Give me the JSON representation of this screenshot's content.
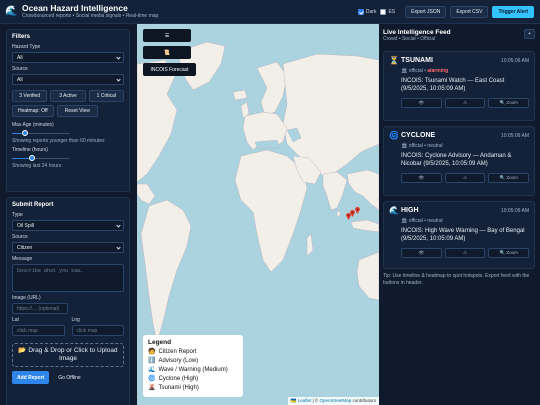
{
  "header": {
    "title": "Ocean Hazard Intelligence",
    "subtitle": "Crowdsourced reports • Social media signals • Real-time map",
    "dark_label": "Dark",
    "es_label": "ES",
    "export_json": "Export JSON",
    "export_csv": "Export CSV",
    "trigger_alert": "Trigger Alert",
    "dark_checked": true,
    "es_checked": false
  },
  "filters": {
    "title": "Filters",
    "hazard_type_label": "Hazard Type",
    "hazard_type_value": "All",
    "source_label": "Source",
    "source_value": "All",
    "verified_btn": "3 Verified",
    "active_btn": "3 Active",
    "critical_btn": "1 Critical",
    "heatmap_btn": "Heatmap: Off",
    "reset_btn": "Reset View",
    "max_age_label": "Max Age (minutes)",
    "max_age_fraction": 0.22,
    "max_age_hint": "Showing reports younger than 60 minutes",
    "timeline_label": "Timeline (hours)",
    "timeline_fraction": 0.34,
    "timeline_hint": "Showing last 24 hours"
  },
  "submit": {
    "title": "Submit Report",
    "type_label": "Type",
    "type_value": "Oil Spill",
    "source_label": "Source",
    "source_value": "Citizen",
    "message_label": "Message",
    "message_placeholder": "Describe what you saw…",
    "image_label": "Image (URL)",
    "image_placeholder": "https://… (optional)",
    "lat_label": "Lat",
    "lat_placeholder": "click map",
    "lng_label": "Lng",
    "lng_placeholder": "click map",
    "dropzone_text": "📂 Drag & Drop or Click to Upload Image",
    "add_btn": "Add Report",
    "offline_btn": "Go Offline"
  },
  "map": {
    "ctl_list_icon": "☰",
    "ctl_scroll_icon": "📜",
    "incois_btn": "INCOIS Forecast",
    "legend_title": "Legend",
    "legend_items": [
      {
        "icon": "🧑",
        "label": "Citizen Report"
      },
      {
        "icon": "ℹ️",
        "label": "Advisory (Low)"
      },
      {
        "icon": "🌊",
        "label": "Wave / Warning (Medium)"
      },
      {
        "icon": "🌀",
        "label": "Cyclone (High)"
      },
      {
        "icon": "🌋",
        "label": "Tsunami (High)"
      }
    ],
    "attribution_flag": "🇺🇦",
    "attribution_leaflet": "Leaflet",
    "attribution_sep": " | © ",
    "attribution_osm": "OpenStreetMap",
    "attribution_tail": " contributors"
  },
  "feed": {
    "title": "Live Intelligence Feed",
    "subtitle": "Crowd • Social • Official",
    "menu_icon": "▪",
    "cards": [
      {
        "icon": "⏳",
        "title": "TSUNAMI",
        "time": "10:05:09 AM",
        "meta": "🏛 official • ",
        "severity": "alarming",
        "body": "INCOIS: Tsunami Watch — East Coast (9/5/2025, 10:05:09 AM)",
        "a1": "👁",
        "a2": "⚠",
        "a3": "🔍 Zoom"
      },
      {
        "icon": "🌀",
        "title": "CYCLONE",
        "time": "10:05:09 AM",
        "meta": "🏛 official • ",
        "severity": "neutral",
        "body": "INCOIS: Cyclone Advisory — Andaman & Nicobar (9/5/2025, 10:05:09 AM)",
        "a1": "👁",
        "a2": "⚠",
        "a3": "🔍 Zoom"
      },
      {
        "icon": "🌊",
        "title": "HIGH",
        "time": "10:05:09 AM",
        "meta": "🏛 official • ",
        "severity": "neutral",
        "body": "INCOIS: High Wave Warning — Bay of Bengal (9/5/2025, 10:05:09 AM)",
        "a1": "👁",
        "a2": "⚠",
        "a3": "🔍 Zoom"
      }
    ],
    "tip": "Tip: Use timeline & heatmap to spot hotspots. Export feed with the buttons in header."
  },
  "colors": {
    "accent": "#2f86ea",
    "alarm": "#ff6b6b",
    "trigger": "#33c3ff",
    "ocean": "#aad3df",
    "land": "#f2efe9"
  }
}
